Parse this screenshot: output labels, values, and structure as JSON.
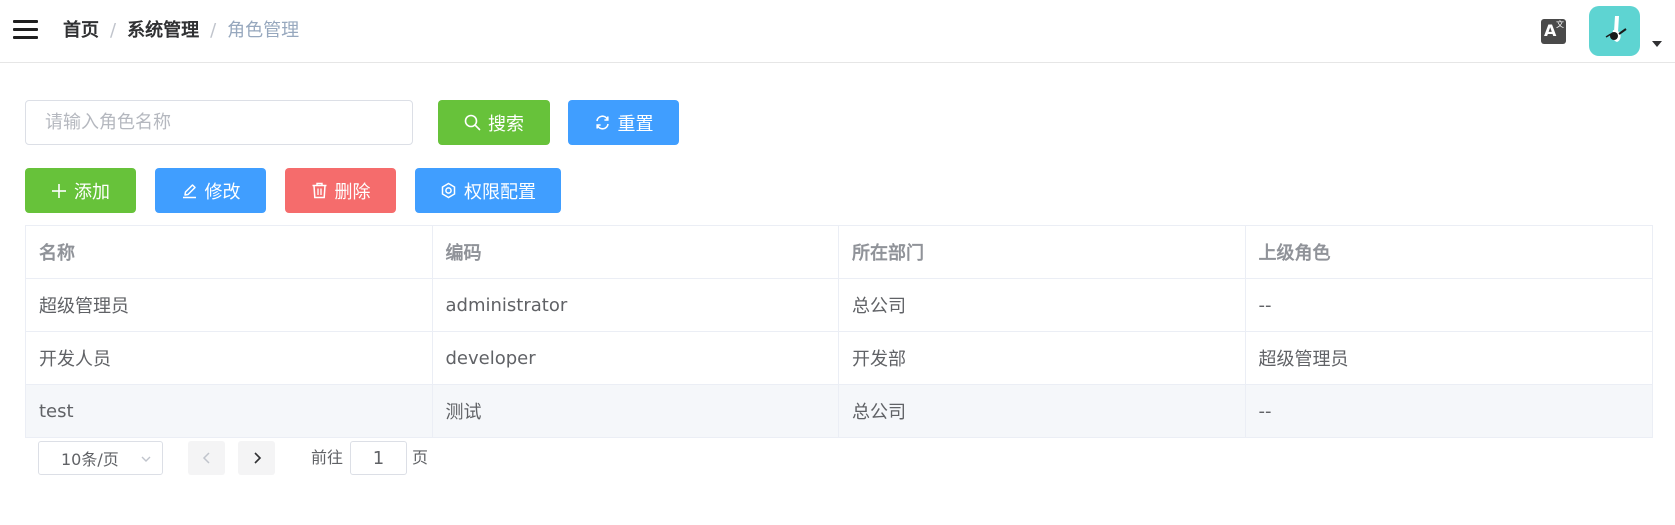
{
  "header": {
    "breadcrumb": {
      "home": "首页",
      "separator": "/",
      "section": "系统管理",
      "current": "角色管理"
    },
    "language_icon": "translate-icon",
    "avatar_icon": "avatar-image"
  },
  "search": {
    "placeholder": "请输入角色名称",
    "value": "",
    "search_label": "搜索",
    "reset_label": "重置"
  },
  "toolbar": {
    "add_label": "添加",
    "edit_label": "修改",
    "delete_label": "删除",
    "permission_label": "权限配置"
  },
  "table": {
    "columns": [
      "名称",
      "编码",
      "所在部门",
      "上级角色"
    ],
    "rows": [
      [
        "超级管理员",
        "administrator",
        "总公司",
        "--"
      ],
      [
        "开发人员",
        "developer",
        "开发部",
        "超级管理员"
      ],
      [
        "test",
        "测试",
        "总公司",
        "--"
      ]
    ]
  },
  "pagination": {
    "page_size": "10条/页",
    "goto_prefix": "前往",
    "current_page": "1",
    "goto_suffix": "页"
  },
  "colors": {
    "primary": "#409eff",
    "success": "#67c23a",
    "danger": "#f56c6c",
    "avatar_bg": "#5ed4d2"
  }
}
